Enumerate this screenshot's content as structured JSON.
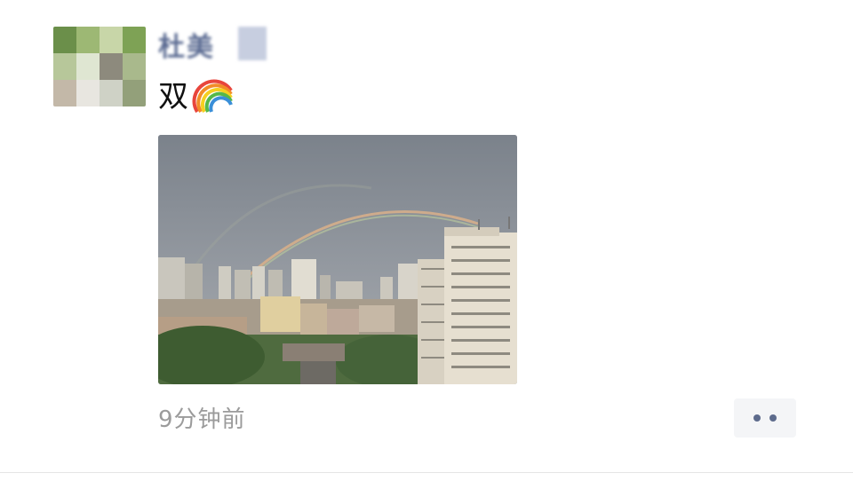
{
  "post": {
    "username": "杜美",
    "text": "双",
    "emoji": "rainbow-emoji",
    "photo": "city-double-rainbow-photo",
    "timestamp": "9分钟前",
    "more_icon": "more-dots-icon"
  },
  "colors": {
    "username": "#5b6b92",
    "timestamp": "#9b9b9b",
    "more_button_bg": "#f4f5f7",
    "more_dots": "#5d6b8c"
  }
}
